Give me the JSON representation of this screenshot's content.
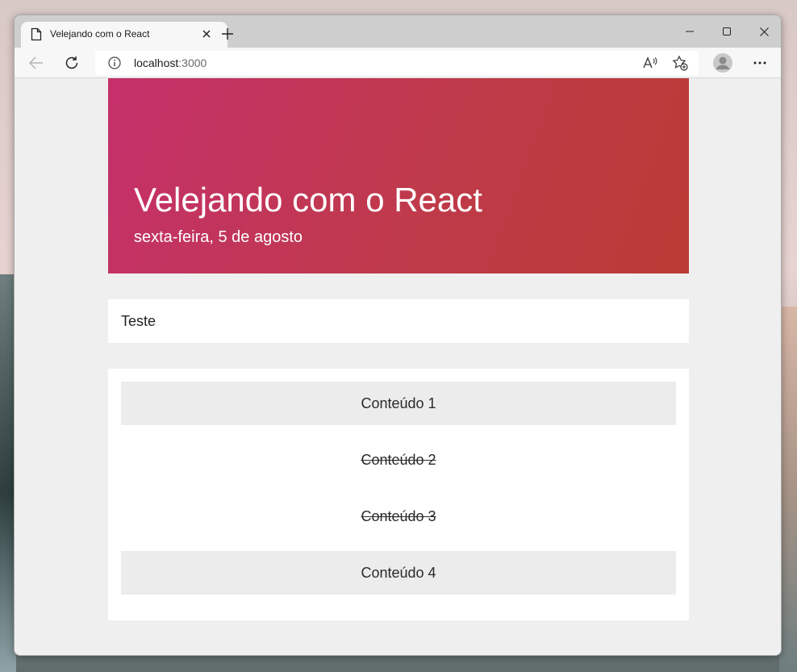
{
  "browser": {
    "tab_title": "Velejando com o React",
    "address_host": "localhost",
    "address_port": ":3000"
  },
  "page": {
    "title": "Velejando com o React",
    "date": "sexta-feira, 5 de agosto",
    "input_value": "Teste",
    "items": [
      {
        "label": "Conteúdo 1",
        "done": false
      },
      {
        "label": "Conteúdo 2",
        "done": true
      },
      {
        "label": "Conteúdo 3",
        "done": true
      },
      {
        "label": "Conteúdo 4",
        "done": false
      }
    ]
  },
  "colors": {
    "hero_start": "#c5306b",
    "hero_end": "#bb3b35",
    "page_bg": "#efefef"
  },
  "icons": [
    "page-icon",
    "close-icon",
    "plus-icon",
    "minimize-icon",
    "maximize-icon",
    "window-close-icon",
    "back-arrow-icon",
    "refresh-icon",
    "info-icon",
    "read-aloud-icon",
    "add-favorite-icon",
    "profile-icon",
    "more-icon"
  ]
}
